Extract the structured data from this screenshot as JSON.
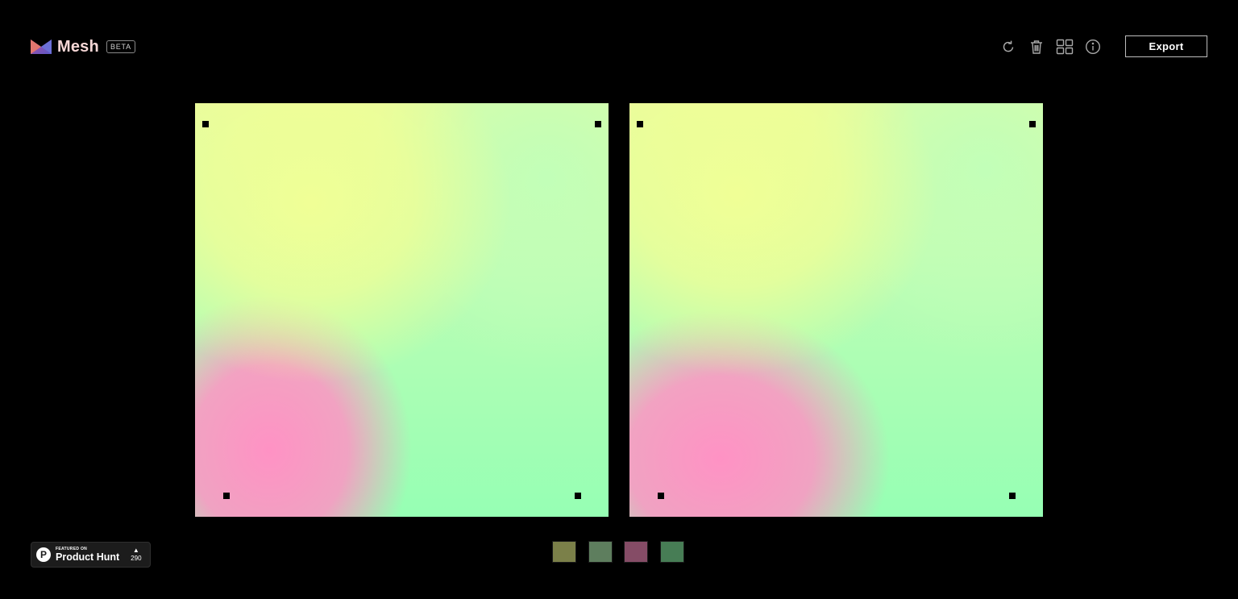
{
  "app": {
    "name": "Mesh",
    "badge": "BETA"
  },
  "toolbar": {
    "icons": [
      "refresh-icon",
      "trash-icon",
      "grid-icon",
      "info-icon"
    ],
    "export_label": "Export"
  },
  "canvases": [
    {
      "name": "mesh-preview-left",
      "colors": [
        "#f0ff96",
        "#c2ffb8",
        "#ff96c2",
        "#96ffb4"
      ]
    },
    {
      "name": "mesh-preview-right",
      "colors": [
        "#f0ff96",
        "#c2ffb8",
        "#ff96c2",
        "#96ffb4"
      ]
    }
  ],
  "swatches": [
    {
      "color": "#7b8049"
    },
    {
      "color": "#5e7e5e"
    },
    {
      "color": "#854c66"
    },
    {
      "color": "#477d55"
    }
  ],
  "product_hunt": {
    "featured_on": "FEATURED ON",
    "name": "Product Hunt",
    "votes": "290"
  }
}
